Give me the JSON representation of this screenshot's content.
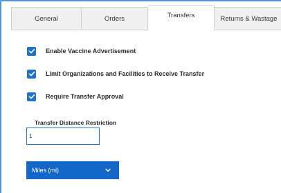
{
  "tabs": [
    {
      "label": "General",
      "active": false
    },
    {
      "label": "Orders",
      "active": false
    },
    {
      "label": "Transfers",
      "active": true
    },
    {
      "label": "Returns & Wastage",
      "active": false
    }
  ],
  "settings": [
    {
      "label": "Enable Vaccine Advertisement",
      "checked": true
    },
    {
      "label": "Limit Organizations and Facilities to Receive Transfer",
      "checked": true
    },
    {
      "label": "Require Transfer Approval",
      "checked": true
    }
  ],
  "distance": {
    "label": "Transfer Distance Restriction",
    "value": "1"
  },
  "unit_select": {
    "selected": "Miles (mi)",
    "icon": "chevron-down-icon"
  },
  "colors": {
    "accent": "#1f73c7",
    "select_bg": "#1267c9",
    "frame_border": "#5b8fd6"
  }
}
